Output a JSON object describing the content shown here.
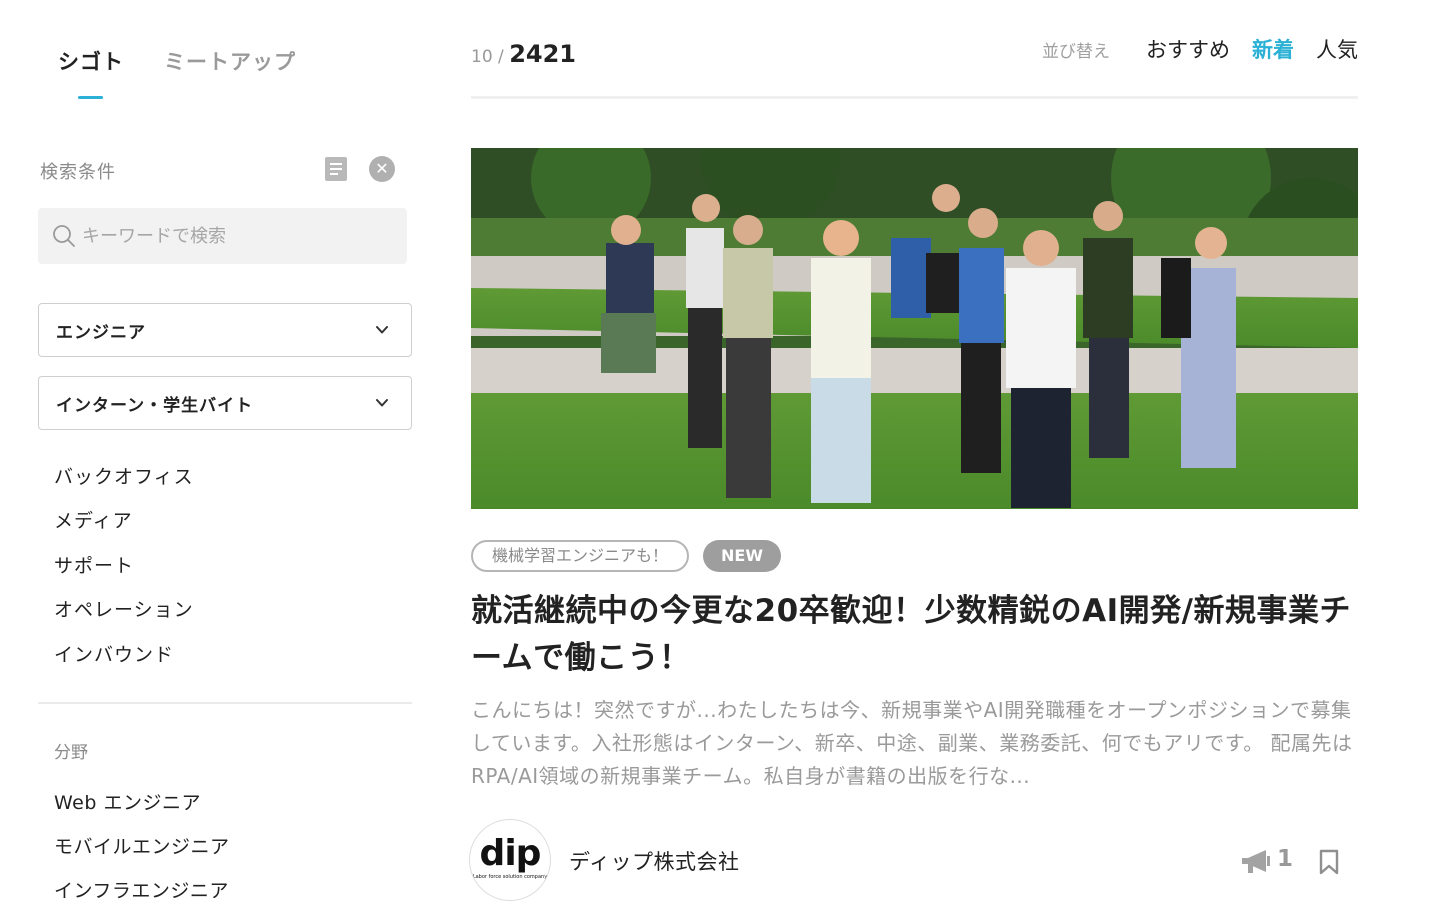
{
  "sidebar": {
    "tabs": [
      {
        "label": "シゴト",
        "active": true
      },
      {
        "label": "ミートアップ",
        "active": false
      }
    ],
    "conditions_label": "検索条件",
    "search": {
      "value": "",
      "placeholder": "キーワードで検索"
    },
    "selects": [
      {
        "value": "エンジニア"
      },
      {
        "value": "インターン・学生バイト"
      }
    ],
    "options": [
      "バックオフィス",
      "メディア",
      "サポート",
      "オペレーション",
      "インバウンド"
    ],
    "field_label": "分野",
    "fields": [
      "Web エンジニア",
      "モバイルエンジニア",
      "インフラエンジニア"
    ]
  },
  "header": {
    "shown": "10",
    "separator": "/",
    "total": "2421",
    "sort_label": "並び替え",
    "sort_options": [
      {
        "label": "おすすめ",
        "active": false
      },
      {
        "label": "新着",
        "active": true
      },
      {
        "label": "人気",
        "active": false
      }
    ]
  },
  "card": {
    "tags": {
      "feature": "機械学習エンジニアも！",
      "new": "NEW"
    },
    "title": "就活継続中の今更な20卒歓迎！少数精鋭のAI開発/新規事業チームで働こう！",
    "description": "こんにちは！突然ですが...わたしたちは今、新規事業やAI開発職種をオープンポジションで募集しています。入社形態はインターン、新卒、中途、副業、業務委託、何でもアリです。 配属先はRPA/AI領域の新規事業チーム。私自身が書籍の出版を行な...",
    "company": {
      "logo_text": "dip",
      "logo_tagline": "Labor force solution company",
      "name": "ディップ株式会社"
    },
    "cheer_count": "1"
  },
  "colors": {
    "accent": "#2bb1d6",
    "muted": "#9a9a9a",
    "tag_new_bg": "#9e9e9e"
  },
  "icons": [
    "search-icon",
    "document-icon",
    "clear-icon",
    "chevron-down-icon",
    "megaphone-icon",
    "bookmark-icon"
  ]
}
